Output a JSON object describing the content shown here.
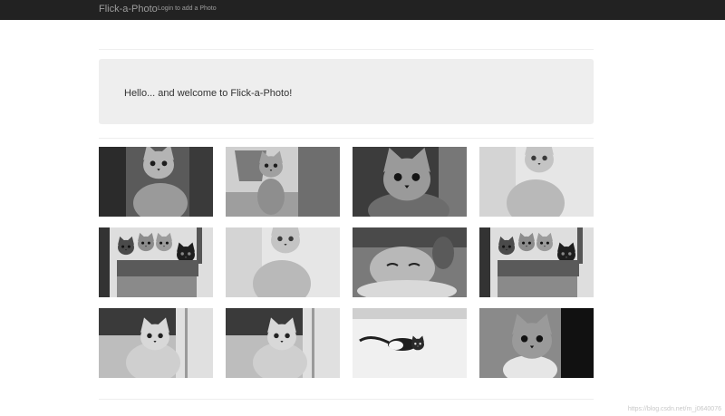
{
  "navbar": {
    "brand": "Flick-a-Photo",
    "login_link": "Login to add a Photo"
  },
  "hero": {
    "text": "Hello... and welcome to Flick-a-Photo!"
  },
  "gallery": {
    "photos": [
      {
        "subject": "kitten-sitting"
      },
      {
        "subject": "tabby-kitten-by-pot"
      },
      {
        "subject": "kitten-face-closeup"
      },
      {
        "subject": "white-kitten"
      },
      {
        "subject": "kittens-in-basket"
      },
      {
        "subject": "white-kitten"
      },
      {
        "subject": "sleeping-kitten"
      },
      {
        "subject": "kittens-in-basket"
      },
      {
        "subject": "kitten-by-doorway"
      },
      {
        "subject": "kitten-by-doorway"
      },
      {
        "subject": "kitten-in-snow"
      },
      {
        "subject": "kitten-on-dark-background"
      }
    ]
  },
  "watermark": "https://blog.csdn.net/m_j0640076"
}
